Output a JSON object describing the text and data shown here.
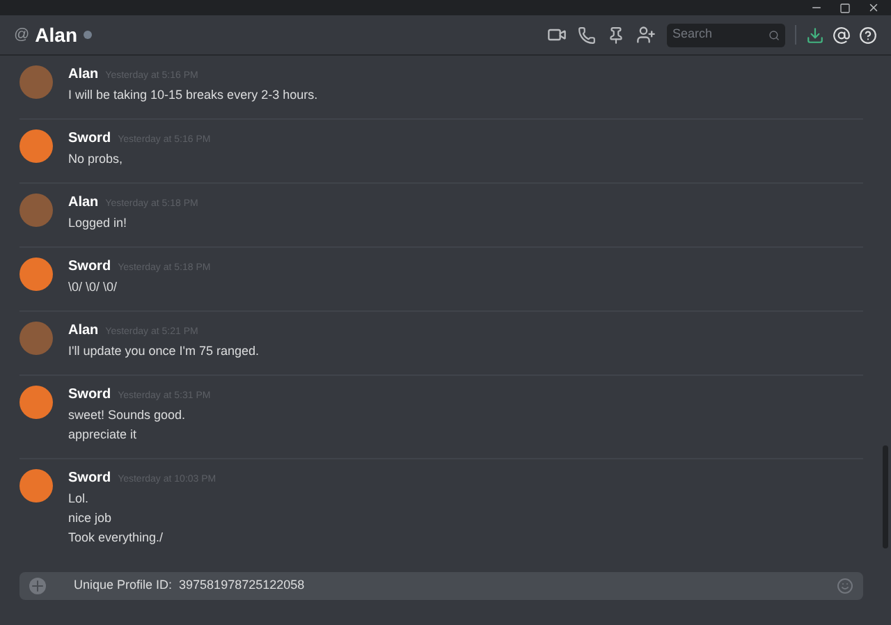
{
  "header": {
    "channel_symbol": "@",
    "title": "Alan",
    "search": {
      "placeholder": "Search"
    }
  },
  "messages": [
    {
      "author": "Alan",
      "color": "#8a5a3a",
      "time": "Yesterday at 5:16 PM",
      "lines": [
        "I will be taking 10-15 breaks every 2-3 hours."
      ]
    },
    {
      "author": "Sword",
      "color": "#e8732a",
      "time": "Yesterday at 5:16 PM",
      "lines": [
        "No probs,"
      ]
    },
    {
      "author": "Alan",
      "color": "#8a5a3a",
      "time": "Yesterday at 5:18 PM",
      "lines": [
        "Logged in!"
      ]
    },
    {
      "author": "Sword",
      "color": "#e8732a",
      "time": "Yesterday at 5:18 PM",
      "lines": [
        "\\0/ \\0/ \\0/"
      ]
    },
    {
      "author": "Alan",
      "color": "#8a5a3a",
      "time": "Yesterday at 5:21 PM",
      "lines": [
        "I'll update you once I'm 75 ranged."
      ]
    },
    {
      "author": "Sword",
      "color": "#e8732a",
      "time": "Yesterday at 5:31 PM",
      "lines": [
        "sweet! Sounds good.",
        "appreciate it"
      ]
    },
    {
      "author": "Sword",
      "color": "#e8732a",
      "time": "Yesterday at 10:03 PM",
      "lines": [
        "Lol.",
        "nice job",
        "Took everything./"
      ]
    }
  ],
  "composer": {
    "value": "Unique Profile ID:  397581978725122058"
  }
}
